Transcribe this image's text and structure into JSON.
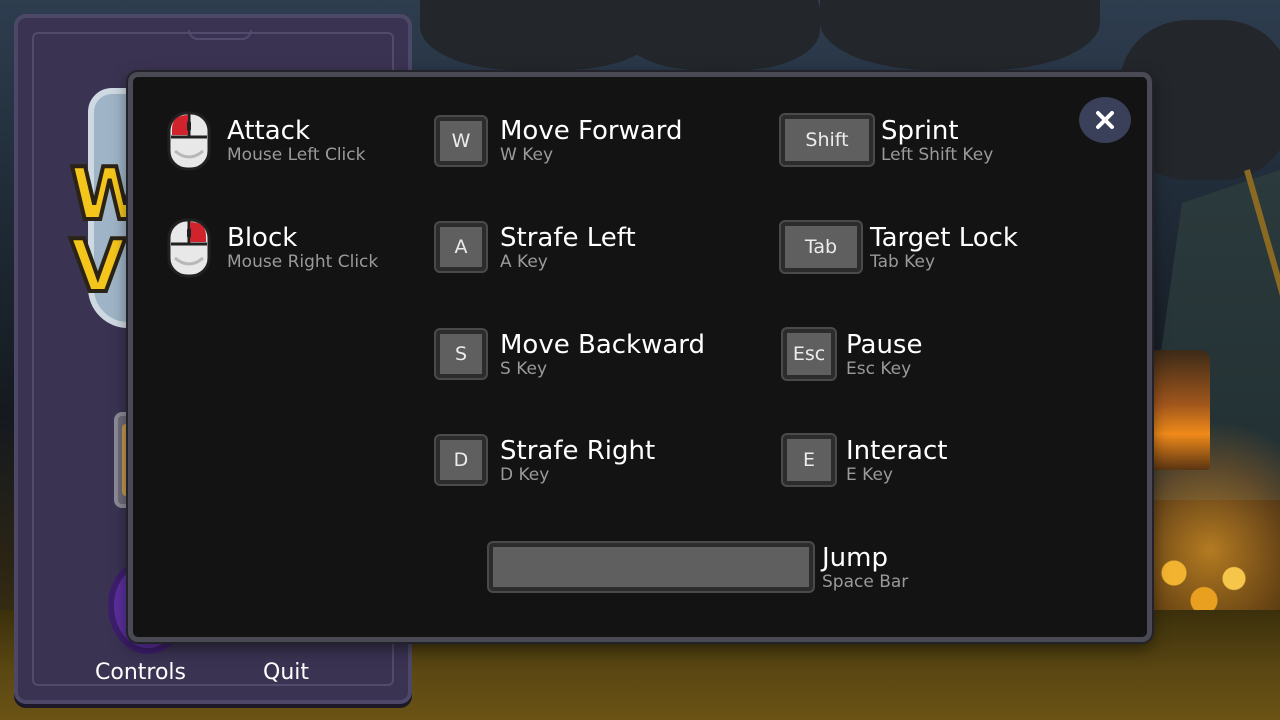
{
  "main_menu": {
    "logo_line1": "W",
    "logo_line2": "V",
    "buttons": [
      {
        "label": "Controls"
      },
      {
        "label": "Quit"
      }
    ]
  },
  "controls": {
    "close_icon": "close-icon",
    "mouse_bindings": [
      {
        "action": "Attack",
        "key": "Mouse Left Click",
        "icon": "mouse-left-click-icon"
      },
      {
        "action": "Block",
        "key": "Mouse Right Click",
        "icon": "mouse-right-click-icon"
      }
    ],
    "movement_bindings": [
      {
        "keycap": "W",
        "action": "Move Forward",
        "key": "W Key"
      },
      {
        "keycap": "A",
        "action": "Strafe Left",
        "key": "A Key"
      },
      {
        "keycap": "S",
        "action": "Move Backward",
        "key": "S Key"
      },
      {
        "keycap": "D",
        "action": "Strafe Right",
        "key": "D Key"
      }
    ],
    "other_bindings": [
      {
        "keycap": "Shift",
        "action": "Sprint",
        "key": "Left Shift Key"
      },
      {
        "keycap": "Tab",
        "action": "Target Lock",
        "key": "Tab Key"
      },
      {
        "keycap": "Esc",
        "action": "Pause",
        "key": "Esc Key"
      },
      {
        "keycap": "E",
        "action": "Interact",
        "key": "E Key"
      }
    ],
    "jump": {
      "keycap": "",
      "action": "Jump",
      "key": "Space Bar"
    }
  },
  "colors": {
    "panel_bg": "#131313",
    "panel_border": "#4a4a55",
    "keycap": "#5f5f5f",
    "action_text": "#ffffff",
    "key_text": "#9a9a9a",
    "mouse_button_highlight": "#d0232b",
    "close_button_bg": "#3a3f5a",
    "menu_panel": "#3a3352",
    "logo_yellow": "#f4c61c"
  }
}
